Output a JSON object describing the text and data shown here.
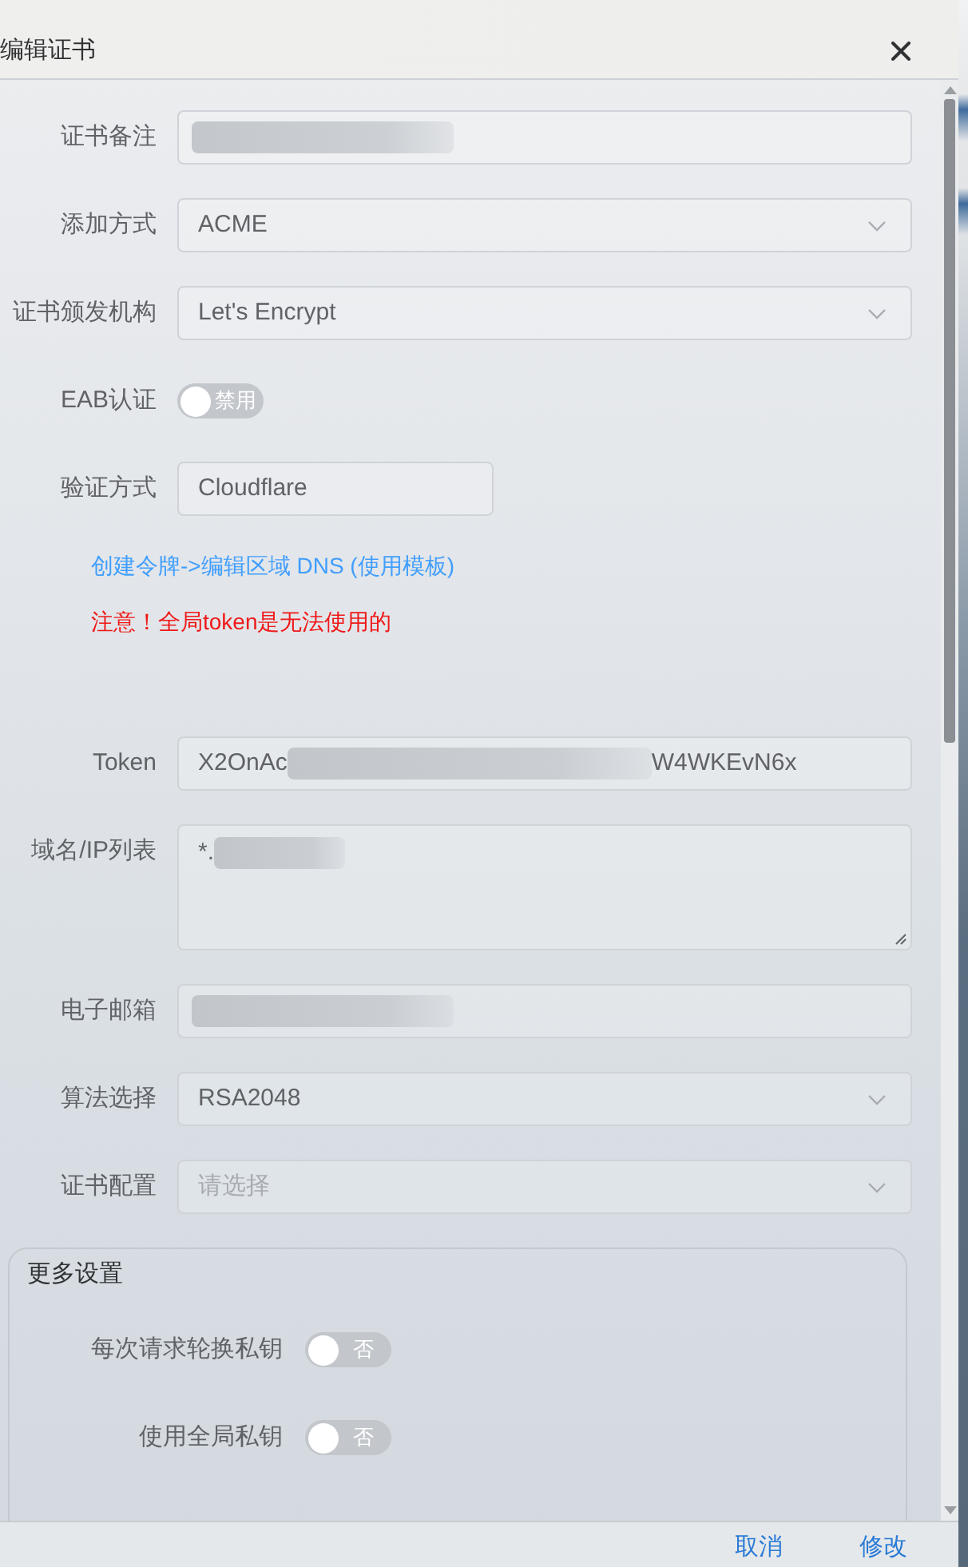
{
  "dialog": {
    "title": "编辑证书"
  },
  "form": [
    {
      "kind": "input",
      "label": "证书备注",
      "redacted": true
    },
    {
      "kind": "select",
      "label": "添加方式",
      "value": "ACME"
    },
    {
      "kind": "select",
      "label": "证书颁发机构",
      "value": "Let's Encrypt"
    },
    {
      "kind": "switch",
      "label": "EAB认证",
      "on": false,
      "text": "禁用"
    },
    {
      "kind": "short-input",
      "label": "验证方式",
      "value": "Cloudflare"
    },
    {
      "kind": "link",
      "text": "创建令牌->编辑区域 DNS (使用模板)"
    },
    {
      "kind": "warning",
      "text": "注意！全局token是无法使用的"
    },
    {
      "kind": "input",
      "label": "Token",
      "value": "X2OnAc",
      "value_end": "W4WKEvN6x",
      "redacted": true
    },
    {
      "kind": "textarea",
      "label": "域名/IP列表",
      "value": "*.",
      "redacted": true
    },
    {
      "kind": "input",
      "label": "电子邮箱",
      "redacted": true
    },
    {
      "kind": "select",
      "label": "算法选择",
      "value": "RSA2048"
    },
    {
      "kind": "select",
      "label": "证书配置",
      "placeholder": "请选择"
    }
  ],
  "more_settings": {
    "title": "更多设置",
    "fields": [
      {
        "label": "每次请求轮换私钥",
        "on": false,
        "text": "否"
      },
      {
        "label": "使用全局私钥",
        "on": false,
        "text": "否"
      }
    ]
  },
  "footer": {
    "buttons": [
      {
        "label": "取消"
      },
      {
        "label": "修改"
      }
    ]
  }
}
